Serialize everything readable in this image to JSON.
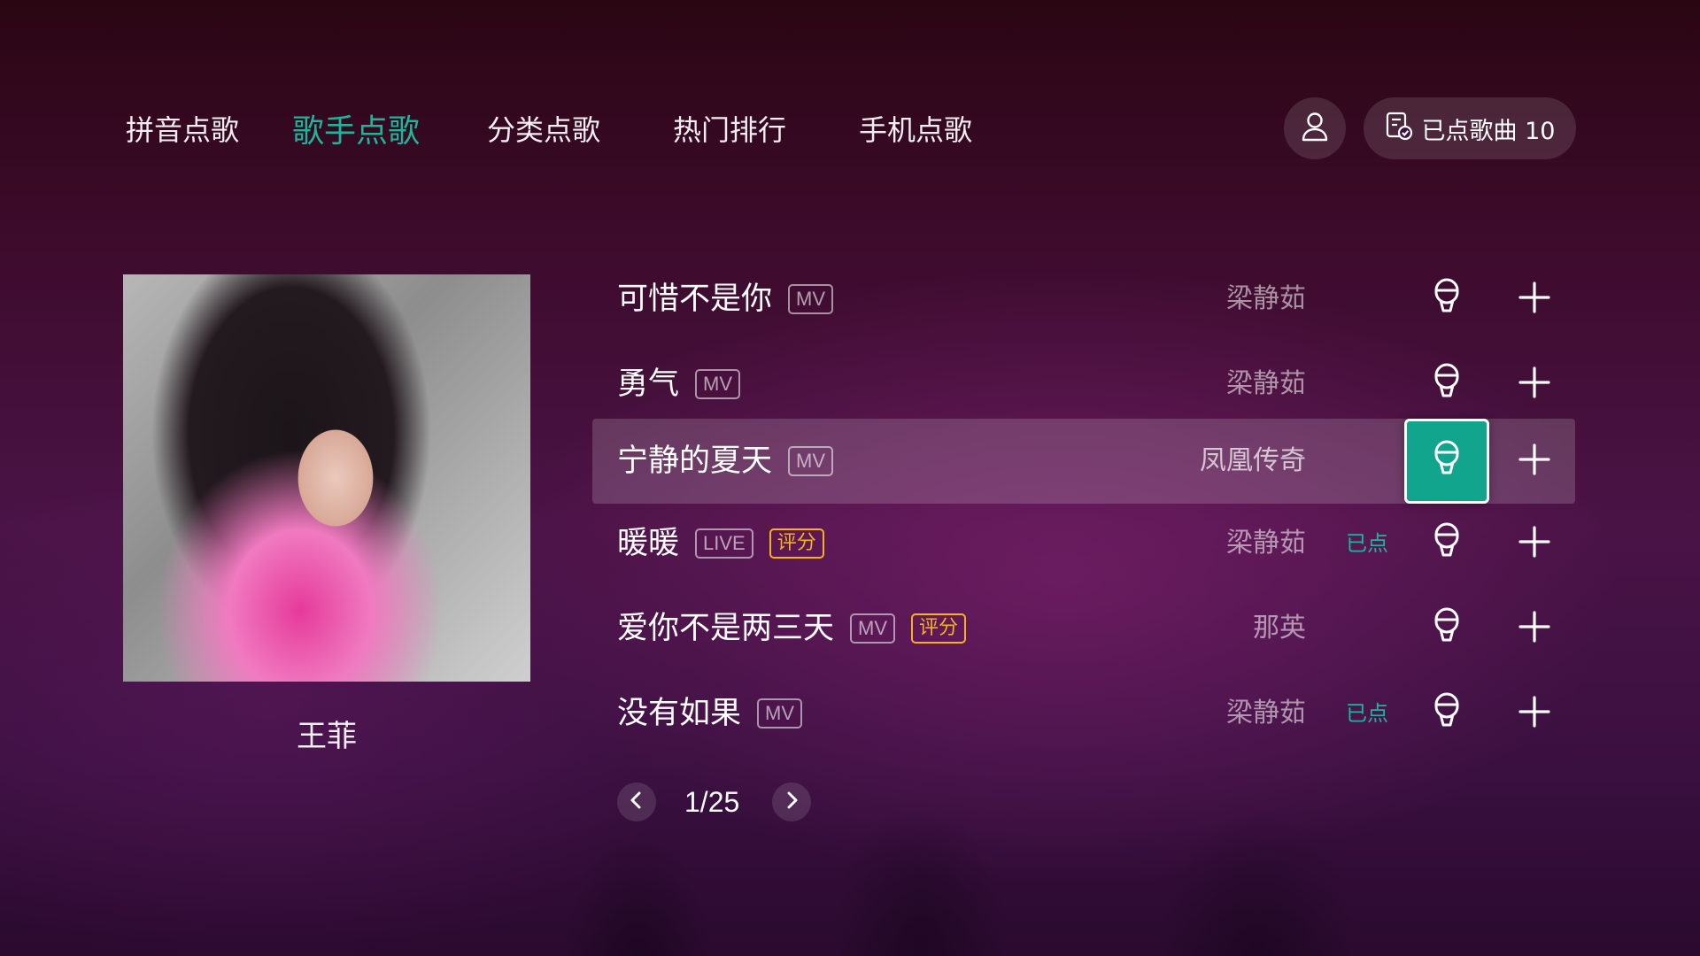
{
  "nav": {
    "items": [
      {
        "label": "拼音点歌",
        "active": false
      },
      {
        "label": "歌手点歌",
        "active": true
      },
      {
        "label": "分类点歌",
        "active": false
      },
      {
        "label": "热门排行",
        "active": false
      },
      {
        "label": "手机点歌",
        "active": false
      }
    ],
    "active_color": "#1fb39a"
  },
  "header": {
    "user_icon": "user-icon",
    "queue_icon": "playlist-check-icon",
    "queue_label": "已点歌曲 10"
  },
  "artist": {
    "name": "王菲"
  },
  "songs": [
    {
      "title": "可惜不是你",
      "tags": [
        "MV"
      ],
      "artist": "梁静茹",
      "played": "",
      "selected": false
    },
    {
      "title": "勇气",
      "tags": [
        "MV"
      ],
      "artist": "梁静茹",
      "played": "",
      "selected": false
    },
    {
      "title": "宁静的夏天",
      "tags": [
        "MV"
      ],
      "artist": "凤凰传奇",
      "played": "",
      "selected": true
    },
    {
      "title": "暖暖",
      "tags": [
        "LIVE",
        "评分"
      ],
      "artist": "梁静茹",
      "played": "已点",
      "selected": false
    },
    {
      "title": "爱你不是两三天",
      "tags": [
        "MV",
        "评分"
      ],
      "artist": "那英",
      "played": "",
      "selected": false
    },
    {
      "title": "没有如果",
      "tags": [
        "MV"
      ],
      "artist": "梁静茹",
      "played": "已点",
      "selected": false
    }
  ],
  "song_actions": {
    "sing_icon": "microphone-icon",
    "add_icon": "plus-icon"
  },
  "pager": {
    "text": "1/25",
    "prev_icon": "chevron-left-icon",
    "next_icon": "chevron-right-icon"
  },
  "colors": {
    "accent": "#1fb39a",
    "score_tag": "#f5b21c",
    "focus_button": "#12a58e"
  }
}
